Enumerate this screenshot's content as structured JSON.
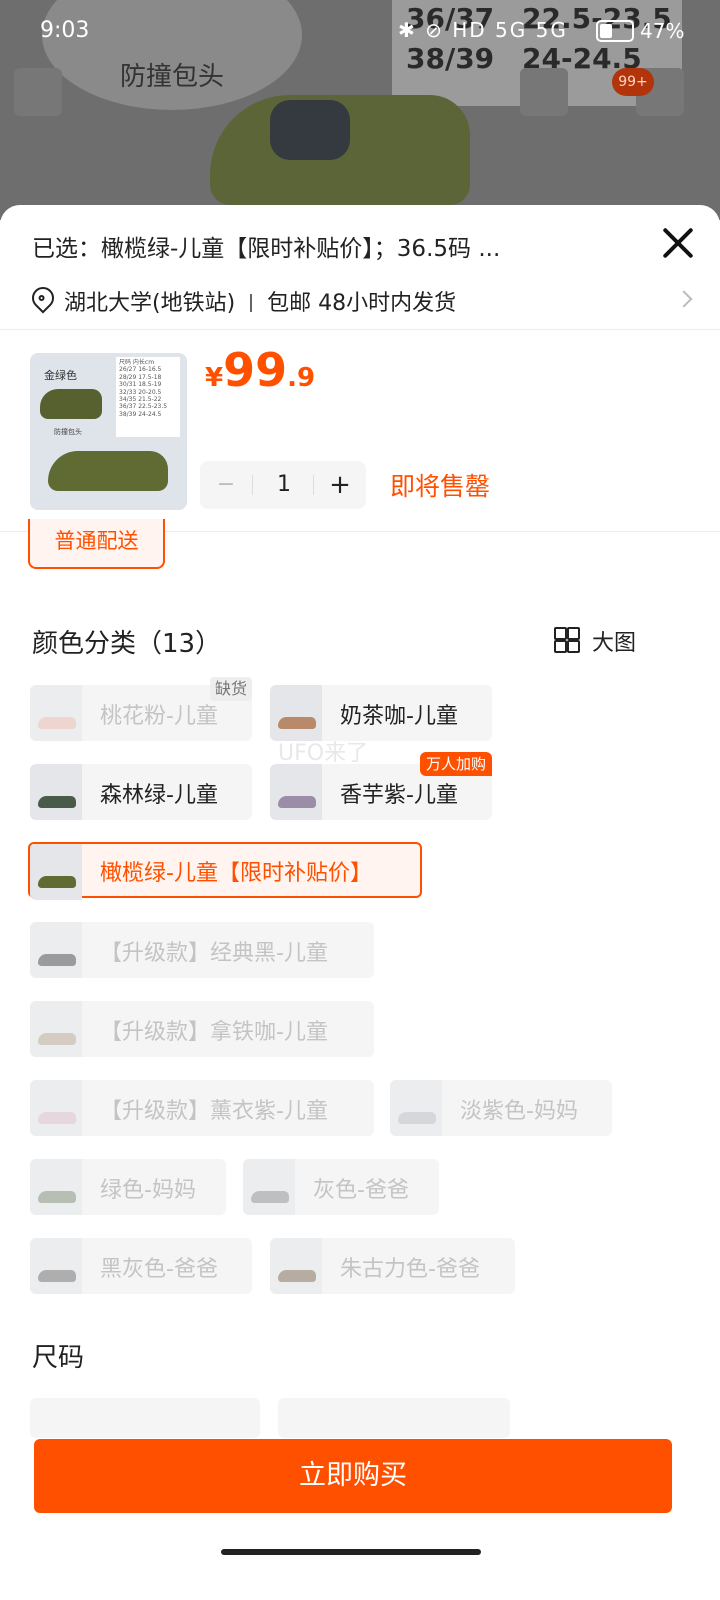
{
  "status_bar": {
    "time": "9:03",
    "icons_text": "✱ ⊘ HD 5G 5G",
    "battery": "47%"
  },
  "backdrop": {
    "label": "防撞包头",
    "table": [
      [
        "36/37",
        "22.5-23.5"
      ],
      [
        "38/39",
        "24-24.5"
      ]
    ],
    "badge": "99+"
  },
  "sheet": {
    "selected_text": "已选：橄榄绿-儿童【限时补贴价】；36.5码 ...",
    "address": "湖北大学(地铁站)",
    "shipping": "包邮 48小时内发货",
    "thumb": {
      "color_label": "金绿色",
      "caption": "防撞包头",
      "table": [
        "尺码  内长cm",
        "26/27  16-16.5",
        "28/29  17.5-18",
        "30/31  18.5-19",
        "32/33  20-20.5",
        "34/35  21.5-22",
        "36/37  22.5-23.5",
        "38/39  24-24.5"
      ]
    },
    "price": {
      "currency": "¥",
      "integer": "99",
      "decimal": ".9"
    },
    "quantity": {
      "minus": "−",
      "value": "1",
      "plus": "+"
    },
    "stock_status": "即将售罄",
    "delivery": "普通配送",
    "color_section": {
      "title": "颜色分类（13）",
      "big_image": "大图",
      "options": [
        {
          "label": "桃花粉-儿童",
          "state": "disabled",
          "tag": "缺货",
          "swatch": "#e8b7ad"
        },
        {
          "label": "奶茶咖-儿童",
          "state": "normal",
          "swatch": "#b88a6a"
        },
        {
          "label": "森林绿-儿童",
          "state": "normal",
          "swatch": "#4a5a48"
        },
        {
          "label": "香芋紫-儿童",
          "state": "normal",
          "tag": "万人加购",
          "swatch": "#9b8ca8"
        },
        {
          "label": "橄榄绿-儿童【限时补贴价】",
          "state": "selected",
          "swatch": "#5f6b33"
        },
        {
          "label": "【升级款】经典黑-儿童",
          "state": "disabled",
          "swatch": "#444"
        },
        {
          "label": "【升级款】拿铁咖-儿童",
          "state": "disabled",
          "swatch": "#b7a48e"
        },
        {
          "label": "【升级款】薰衣紫-儿童",
          "state": "disabled",
          "swatch": "#d9b8c8"
        },
        {
          "label": "淡紫色-妈妈",
          "state": "disabled",
          "swatch": "#b9b9c3"
        },
        {
          "label": "绿色-妈妈",
          "state": "disabled",
          "swatch": "#7a8a76"
        },
        {
          "label": "灰色-爸爸",
          "state": "disabled",
          "swatch": "#8b8b8b"
        },
        {
          "label": "黑灰色-爸爸",
          "state": "disabled",
          "swatch": "#6a6a6a"
        },
        {
          "label": "朱古力色-爸爸",
          "state": "disabled",
          "swatch": "#7a6550"
        }
      ]
    },
    "watermark": "UFO来了",
    "size_section": {
      "title": "尺码"
    },
    "buy_button": "立即购买"
  },
  "colors": {
    "accent": "#ff5000"
  }
}
